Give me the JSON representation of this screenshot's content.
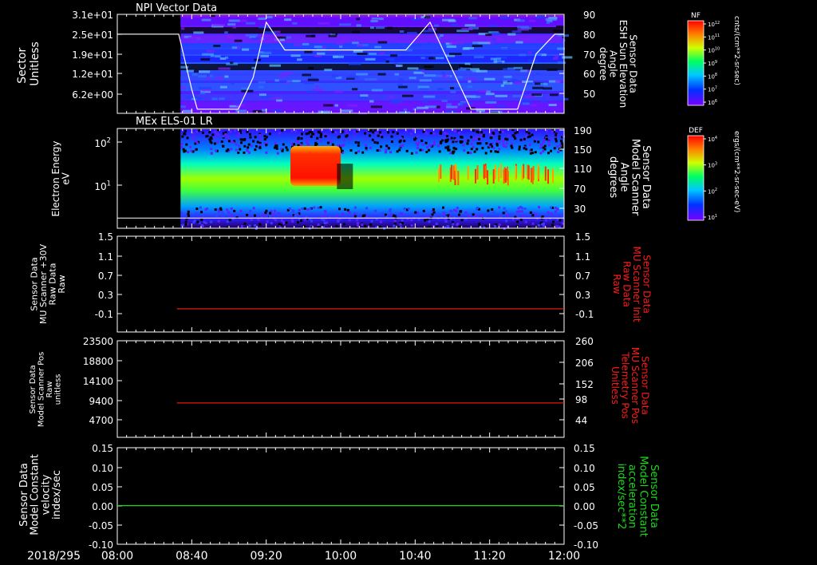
{
  "colors": {
    "background": "#000000",
    "axis": "#ffffff",
    "red_trace": "#ff1a1a",
    "green_trace": "#1adb1a"
  },
  "time_axis": {
    "date_label": "2018/295",
    "ticks": [
      "08:00",
      "08:40",
      "09:20",
      "10:00",
      "10:40",
      "11:20",
      "12:00"
    ]
  },
  "chart_data": [
    {
      "type": "heatmap",
      "title": "NPI Vector Data",
      "left_axis": {
        "label": "Sector\nUnitless",
        "ticks": [
          "3.1e+01",
          "2.5e+01",
          "1.9e+01",
          "1.2e+01",
          "6.2e+00"
        ]
      },
      "right_axis": {
        "label": "Sensor Data\nESH Sun Elevation\nAngle\ndegree",
        "ticks": [
          "90",
          "80",
          "70",
          "60",
          "50"
        ]
      },
      "colorbar": {
        "title": "NF",
        "unit": "cnts/(cm**2-sr-sec)",
        "tick_labels": [
          "10^12",
          "10^11",
          "10^10",
          "10^9",
          "10^8",
          "10^7",
          "10^6"
        ],
        "exp": [
          "12",
          "11",
          "10",
          "9",
          "8",
          "7",
          "6"
        ]
      },
      "data_start": "08:34",
      "overlay_line": {
        "name": "ESH Sun Elevation Angle",
        "points": [
          [
            "08:00",
            80
          ],
          [
            "08:33",
            80
          ],
          [
            "08:40",
            52
          ],
          [
            "08:43",
            42
          ],
          [
            "09:05",
            42
          ],
          [
            "09:13",
            58
          ],
          [
            "09:20",
            86
          ],
          [
            "09:30",
            72
          ],
          [
            "10:35",
            72
          ],
          [
            "10:48",
            86
          ],
          [
            "10:55",
            72
          ],
          [
            "11:10",
            42
          ],
          [
            "11:35",
            42
          ],
          [
            "11:45",
            70
          ],
          [
            "11:55",
            80
          ],
          [
            "12:00",
            80
          ]
        ]
      }
    },
    {
      "type": "heatmap",
      "title": "MEx ELS-01 LR",
      "left_axis": {
        "label": "Electron Energy\neV",
        "ticks": [
          "10^2",
          "10^1"
        ],
        "exp": [
          "2",
          "1"
        ]
      },
      "right_axis": {
        "label": "Sensor Data\nModel Scanner\nAngle\ndegrees",
        "ticks": [
          "190",
          "150",
          "110",
          "70",
          "30"
        ]
      },
      "colorbar": {
        "title": "DEF",
        "unit": "ergs/(cm**2-sr-sec-eV)",
        "tick_labels": [
          "10^4",
          "10^3",
          "10^2",
          "10^1"
        ],
        "exp": [
          "4",
          "3",
          "2",
          "1"
        ]
      },
      "data_start": "08:34",
      "overlay_line": {
        "name": "Model Scanner Angle",
        "value": 10
      }
    },
    {
      "type": "line",
      "left_axis": {
        "label": "Sensor Data\nMU Scanner +30V\nRaw Data\nRaw",
        "ticks": [
          "1.5",
          "1.1",
          "0.7",
          "0.3",
          "-0.1"
        ]
      },
      "right_axis": {
        "label": "Sensor Data\nMU Scanner Init\nRaw Data\nRaw",
        "ticks": [
          "1.5",
          "1.1",
          "0.7",
          "0.3",
          "-0.1"
        ]
      },
      "ylim": [
        -0.5,
        1.5
      ],
      "series": [
        {
          "name": "Sensor Data MU Scanner Init Raw Data",
          "x": [
            "08:32",
            "12:00"
          ],
          "values": [
            0,
            0
          ]
        }
      ]
    },
    {
      "type": "line",
      "left_axis": {
        "label": "Sensor Data\nModel Scanner Pos\nRaw\nunitless",
        "ticks": [
          "23500",
          "18800",
          "14100",
          "9400",
          "4700"
        ]
      },
      "right_axis": {
        "label": "Sensor Data\nMU Scanner Pos\nTelemetry Pos\nUnitless",
        "ticks": [
          "260",
          "206",
          "152",
          "98",
          "44"
        ]
      },
      "right_ylim": [
        0,
        260
      ],
      "series": [
        {
          "name": "Sensor Data MU Scanner Pos Telemetry Pos",
          "x": [
            "08:32",
            "12:00"
          ],
          "values": [
            90,
            90
          ]
        }
      ]
    },
    {
      "type": "line",
      "left_axis": {
        "label": "Sensor Data\nModel Constant\nvelocity\nindex/sec",
        "ticks": [
          "0.15",
          "0.10",
          "0.05",
          "0.00",
          "-0.05",
          "-0.10"
        ]
      },
      "right_axis": {
        "label": "Sensor Data\nModel Constant\nacceleration\nindex/sec**2",
        "ticks": [
          "0.15",
          "0.10",
          "0.05",
          "0.00",
          "-0.05",
          "-0.10"
        ]
      },
      "ylim": [
        -0.1,
        0.15
      ],
      "series": [
        {
          "name": "Sensor Data Model Constant acceleration",
          "x": [
            "08:00",
            "12:00"
          ],
          "values": [
            0,
            0
          ]
        }
      ]
    }
  ]
}
